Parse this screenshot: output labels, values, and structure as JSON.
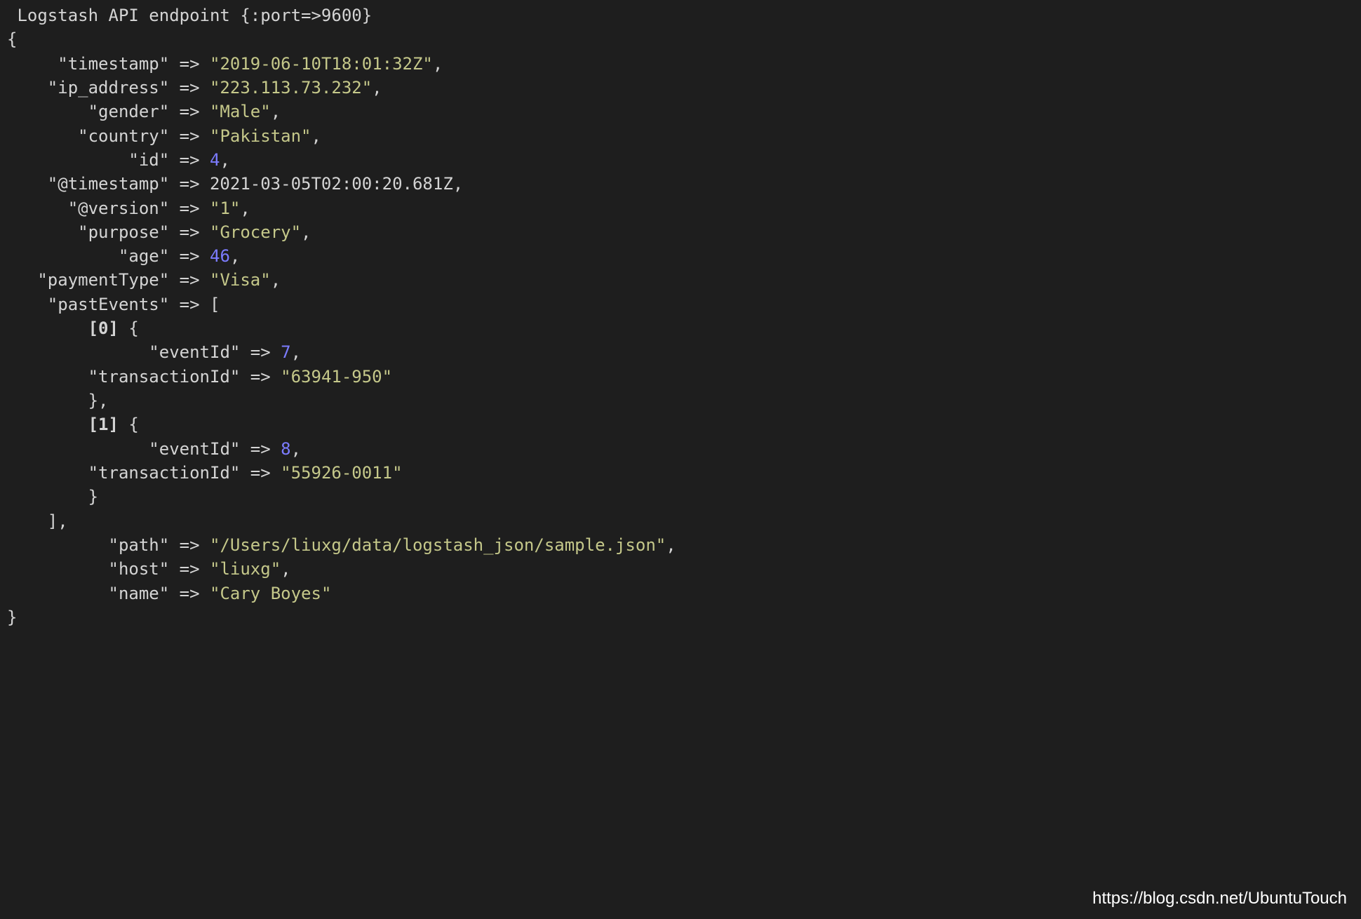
{
  "header": " Logstash API endpoint {:port=>9600}",
  "fields": {
    "timestamp": {
      "key": "\"timestamp\"",
      "value": "\"2019-06-10T18:01:32Z\"",
      "type": "string",
      "padding": "     "
    },
    "ip_address": {
      "key": "\"ip_address\"",
      "value": "\"223.113.73.232\"",
      "type": "string",
      "padding": "    "
    },
    "gender": {
      "key": "\"gender\"",
      "value": "\"Male\"",
      "type": "string",
      "padding": "        "
    },
    "country": {
      "key": "\"country\"",
      "value": "\"Pakistan\"",
      "type": "string",
      "padding": "       "
    },
    "id": {
      "key": "\"id\"",
      "value": "4",
      "type": "number",
      "padding": "            "
    },
    "at_timestamp": {
      "key": "\"@timestamp\"",
      "value": "2021-03-05T02:00:20.681Z",
      "type": "plain",
      "padding": "    "
    },
    "at_version": {
      "key": "\"@version\"",
      "value": "\"1\"",
      "type": "string",
      "padding": "      "
    },
    "purpose": {
      "key": "\"purpose\"",
      "value": "\"Grocery\"",
      "type": "string",
      "padding": "       "
    },
    "age": {
      "key": "\"age\"",
      "value": "46",
      "type": "number",
      "padding": "           "
    },
    "paymentType": {
      "key": "\"paymentType\"",
      "value": "\"Visa\"",
      "type": "string",
      "padding": "   "
    },
    "pastEvents": {
      "key": "\"pastEvents\"",
      "padding": "    "
    },
    "path": {
      "key": "\"path\"",
      "value": "\"/Users/liuxg/data/logstash_json/sample.json\"",
      "type": "string",
      "padding": "          "
    },
    "host": {
      "key": "\"host\"",
      "value": "\"liuxg\"",
      "type": "string",
      "padding": "          "
    },
    "name": {
      "key": "\"name\"",
      "value": "\"Cary Boyes\"",
      "type": "string",
      "padding": "          "
    }
  },
  "pastEvents": [
    {
      "index": "[0]",
      "eventId": {
        "key": "\"eventId\"",
        "value": "7",
        "padding": "              "
      },
      "transactionId": {
        "key": "\"transactionId\"",
        "value": "\"63941-950\"",
        "padding": "        "
      }
    },
    {
      "index": "[1]",
      "eventId": {
        "key": "\"eventId\"",
        "value": "8",
        "padding": "              "
      },
      "transactionId": {
        "key": "\"transactionId\"",
        "value": "\"55926-0011\"",
        "padding": "        "
      }
    }
  ],
  "arrow": " => ",
  "open_brace": "{",
  "close_brace": "}",
  "open_bracket": "[",
  "close_bracket": "]",
  "comma": ",",
  "watermark": "https://blog.csdn.net/UbuntuTouch"
}
